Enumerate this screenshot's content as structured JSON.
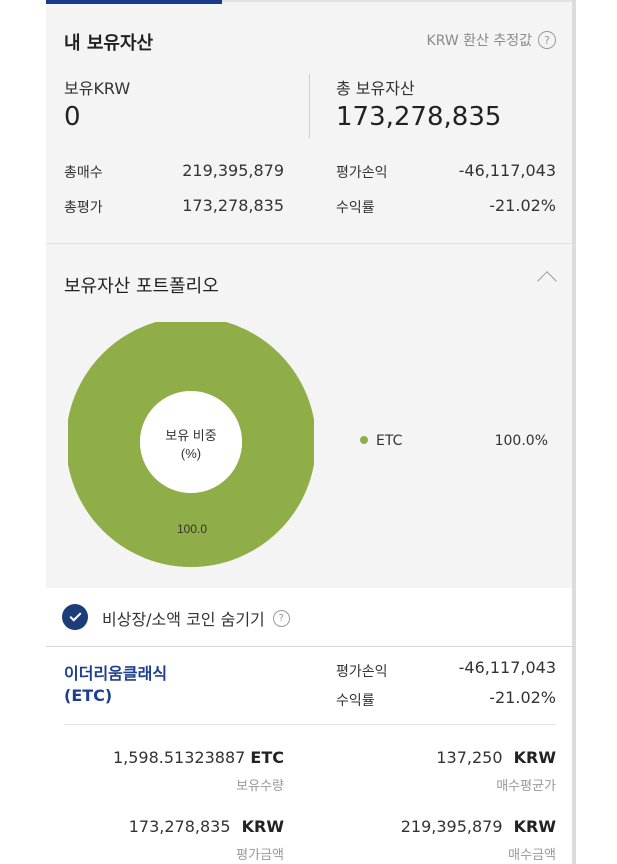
{
  "holdings": {
    "title": "내 보유자산",
    "krw_estimate_label": "KRW 환산 추정값",
    "held_krw_label": "보유KRW",
    "held_krw_value": "0",
    "total_assets_label": "총 보유자산",
    "total_assets_value": "173,278,835",
    "total_buy_label": "총매수",
    "total_buy_value": "219,395,879",
    "total_eval_label": "총평가",
    "total_eval_value": "173,278,835",
    "pnl_label": "평가손익",
    "pnl_value": "-46,117,043",
    "roi_label": "수익률",
    "roi_value": "-21.02%"
  },
  "portfolio": {
    "title": "보유자산 포트폴리오",
    "donut_center_line1": "보유 비중",
    "donut_center_line2": "(%)",
    "slice_label": "100.0",
    "legend": [
      {
        "name": "ETC",
        "percent": "100.0%",
        "color": "#8fae47"
      }
    ]
  },
  "chart_data": {
    "type": "pie",
    "categories": [
      "ETC"
    ],
    "values": [
      100.0
    ],
    "colors": [
      "#8fae47"
    ],
    "title": "보유 비중 (%)",
    "legend_position": "right"
  },
  "filter": {
    "hide_label": "비상장/소액 코인 숨기기",
    "checked": true
  },
  "coin": {
    "name_line1": "이더리움클래식",
    "name_line2": "(ETC)",
    "pnl_label": "평가손익",
    "pnl_value": "-46,117,043",
    "roi_label": "수익률",
    "roi_value": "-21.02%",
    "quantity_value": "1,598.51323887",
    "quantity_unit": "ETC",
    "quantity_label": "보유수량",
    "avg_price_value": "137,250",
    "avg_price_unit": "KRW",
    "avg_price_label": "매수평균가",
    "eval_amount_value": "173,278,835",
    "eval_amount_unit": "KRW",
    "eval_amount_label": "평가금액",
    "buy_amount_value": "219,395,879",
    "buy_amount_unit": "KRW",
    "buy_amount_label": "매수금액"
  },
  "colors": {
    "accent": "#1a3a8c",
    "negative": "#1f60b5",
    "donut": "#8fae47"
  }
}
